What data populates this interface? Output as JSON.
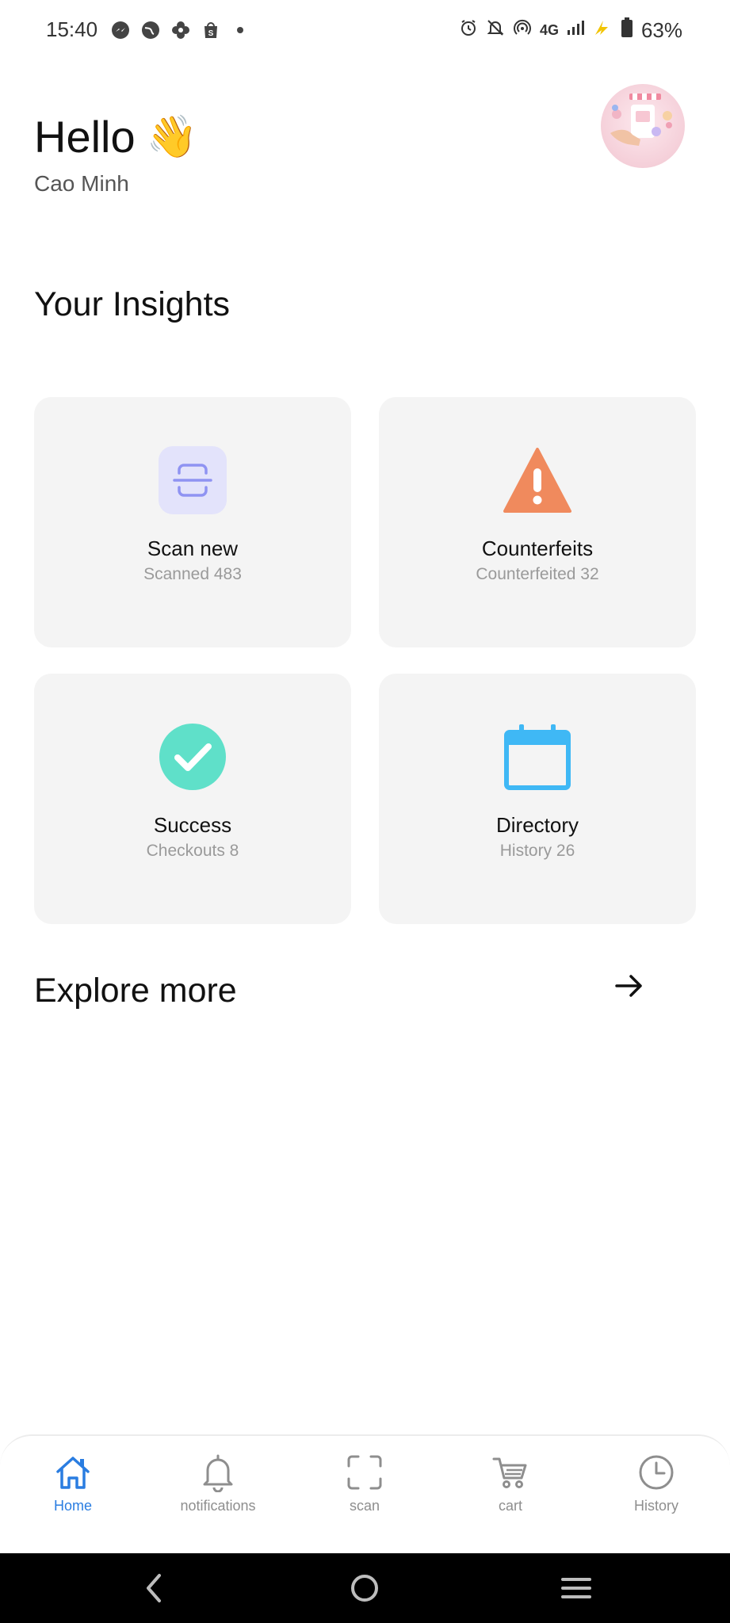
{
  "status_bar": {
    "time": "15:40",
    "network": "4G",
    "battery": "63%"
  },
  "header": {
    "greeting": "Hello",
    "wave_emoji": "👋",
    "user_name": "Cao Minh"
  },
  "insights": {
    "title": "Your Insights",
    "cards": [
      {
        "title": "Scan new",
        "subtitle": "Scanned 483",
        "icon": "scan-icon",
        "color": "#8f93f2"
      },
      {
        "title": "Counterfeits",
        "subtitle": "Counterfeited 32",
        "icon": "warning-icon",
        "color": "#f08a5d"
      },
      {
        "title": "Success",
        "subtitle": "Checkouts 8",
        "icon": "check-circle-icon",
        "color": "#5fe0c9"
      },
      {
        "title": "Directory",
        "subtitle": "History 26",
        "icon": "calendar-icon",
        "color": "#3fb8f5"
      }
    ]
  },
  "explore": {
    "title": "Explore more"
  },
  "bottom_nav": {
    "items": [
      {
        "label": "Home",
        "icon": "home-icon",
        "active": true
      },
      {
        "label": "notifications",
        "icon": "bell-icon",
        "active": false
      },
      {
        "label": "scan",
        "icon": "scan-frame-icon",
        "active": false
      },
      {
        "label": "cart",
        "icon": "cart-icon",
        "active": false
      },
      {
        "label": "History",
        "icon": "clock-icon",
        "active": false
      }
    ]
  },
  "colors": {
    "accent": "#2a7de1",
    "card_bg": "#f4f4f4"
  }
}
